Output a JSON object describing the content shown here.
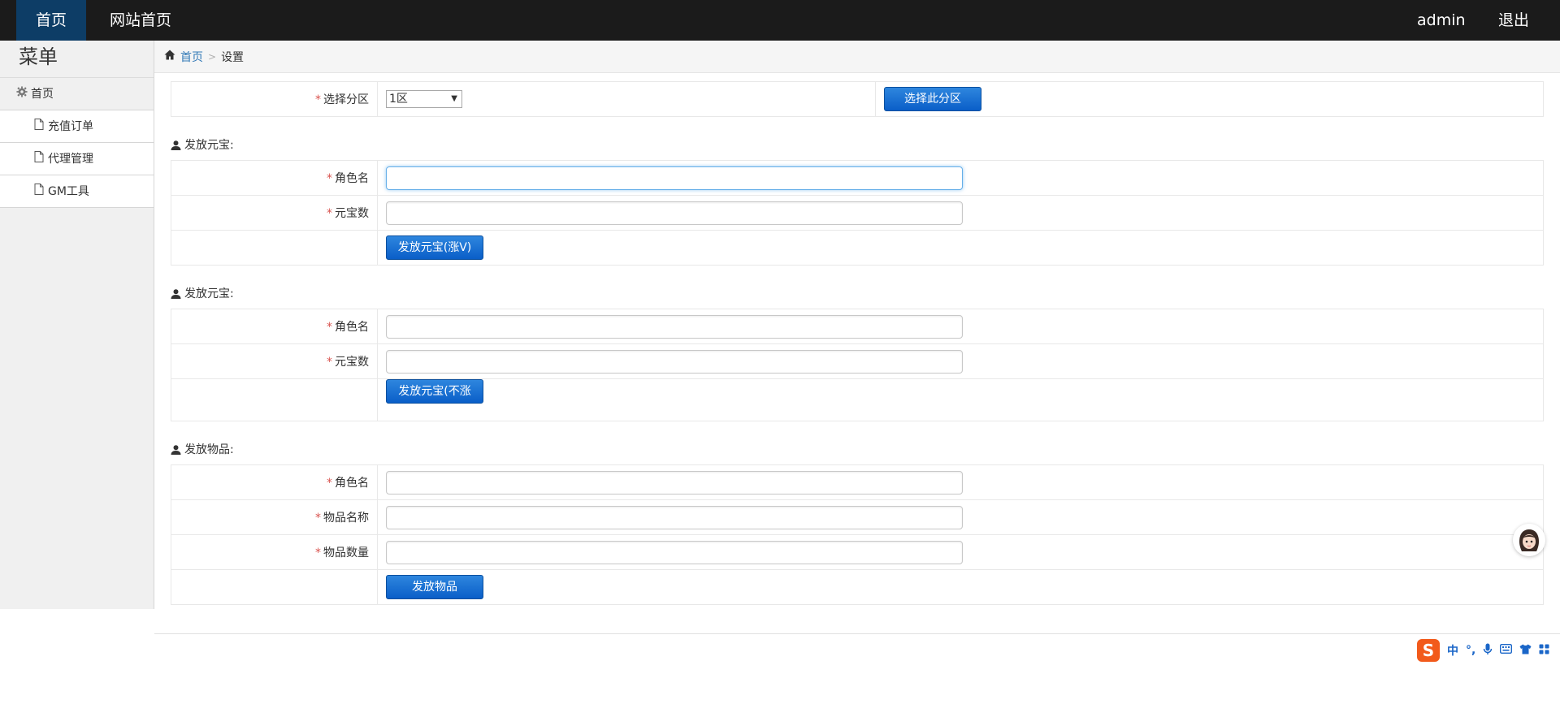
{
  "topbar": {
    "home": "首页",
    "site_home": "网站首页",
    "user": "admin",
    "logout": "退出"
  },
  "sidebar": {
    "title": "菜单",
    "home": "首页",
    "items": [
      {
        "label": "充值订单"
      },
      {
        "label": "代理管理"
      },
      {
        "label": "GM工具"
      }
    ]
  },
  "breadcrumb": {
    "home": "首页",
    "current": "设置"
  },
  "zone": {
    "label": "选择分区",
    "selected": "1区",
    "button": "选择此分区"
  },
  "sections": [
    {
      "title": "发放元宝:",
      "fields": [
        {
          "label": "角色名",
          "value": ""
        },
        {
          "label": "元宝数",
          "value": ""
        }
      ],
      "button": "发放元宝(涨V)"
    },
    {
      "title": "发放元宝:",
      "fields": [
        {
          "label": "角色名",
          "value": ""
        },
        {
          "label": "元宝数",
          "value": ""
        }
      ],
      "button": "发放元宝(不涨V)"
    },
    {
      "title": "发放物品:",
      "fields": [
        {
          "label": "角色名",
          "value": ""
        },
        {
          "label": "物品名称",
          "value": ""
        },
        {
          "label": "物品数量",
          "value": ""
        }
      ],
      "button": "发放物品"
    }
  ],
  "required_mark": "*",
  "ime": {
    "logo": "S",
    "mode": "中",
    "punct": "°,"
  }
}
